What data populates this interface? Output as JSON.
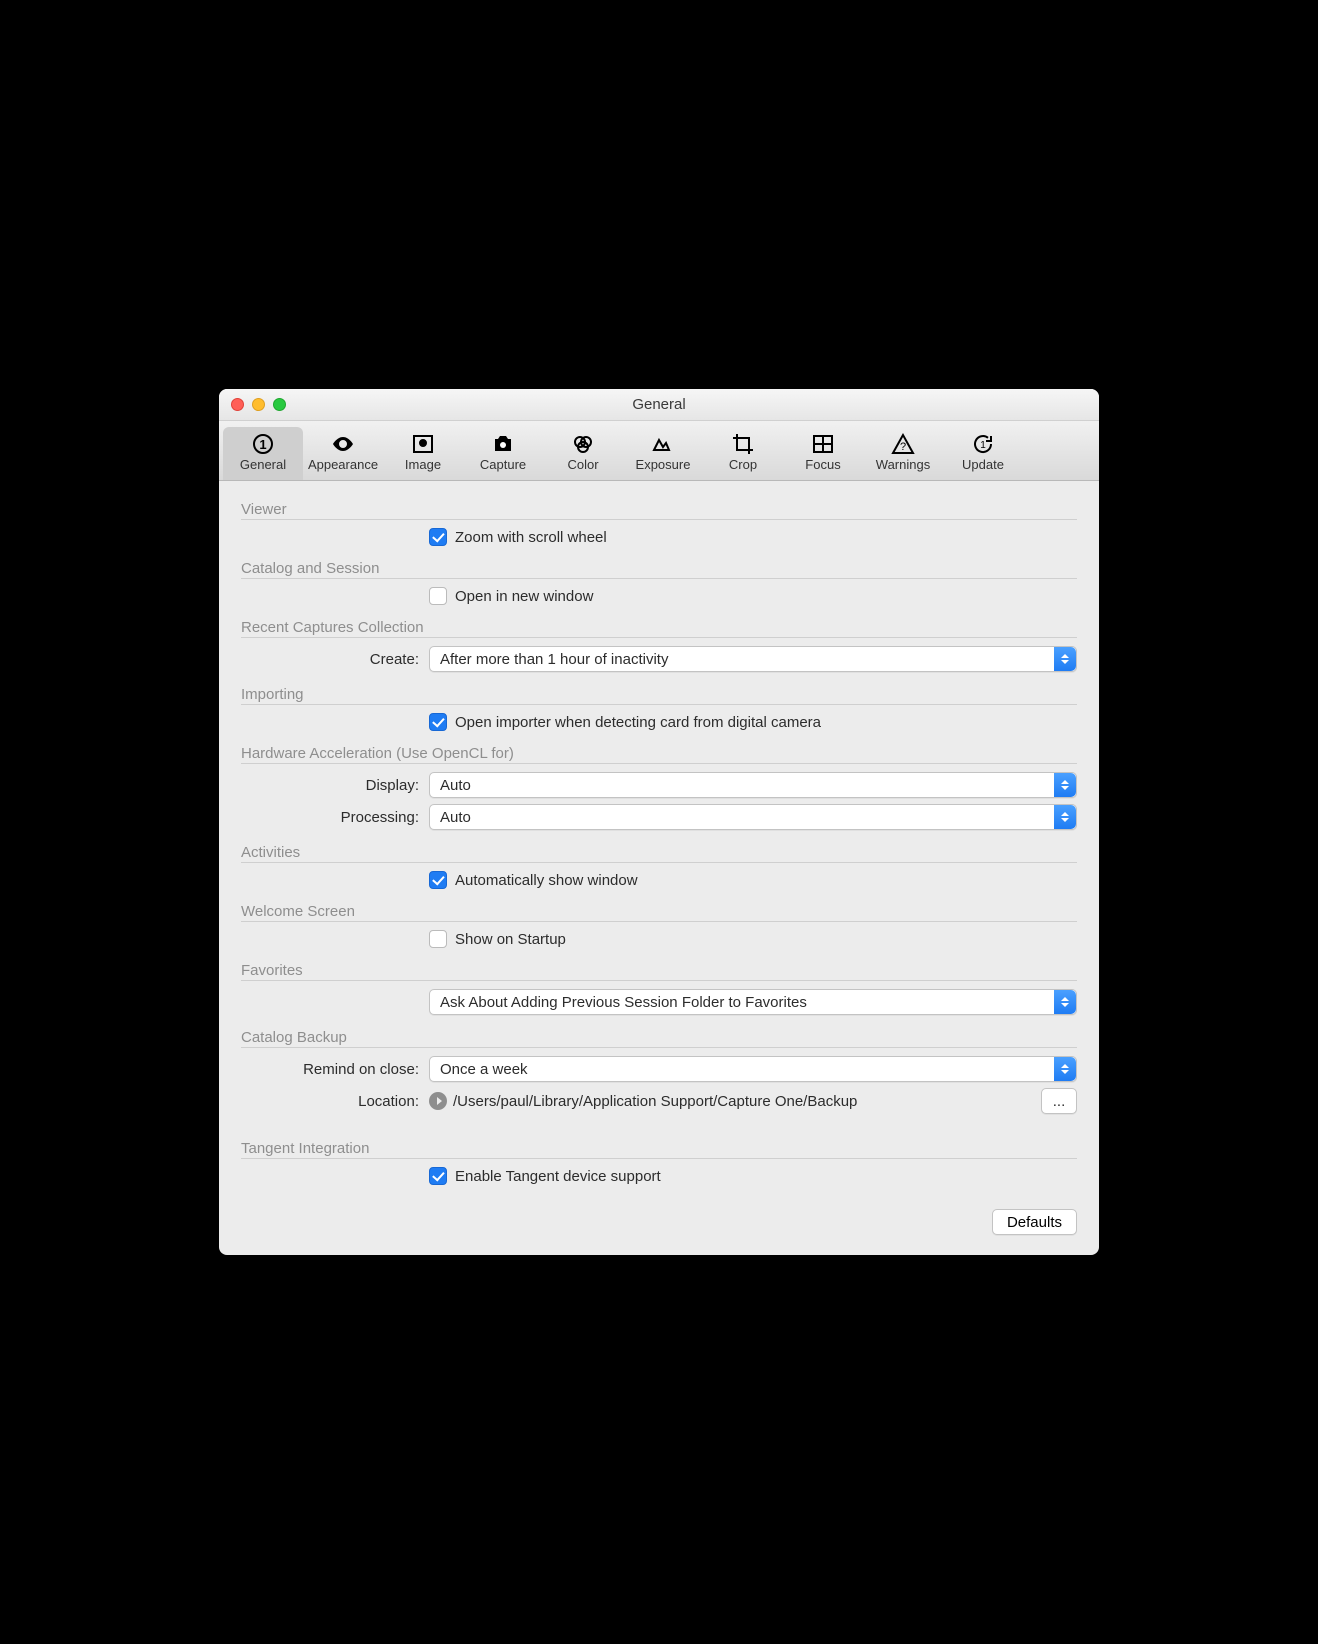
{
  "window": {
    "title": "General"
  },
  "toolbar": {
    "tabs": [
      {
        "label": "General"
      },
      {
        "label": "Appearance"
      },
      {
        "label": "Image"
      },
      {
        "label": "Capture"
      },
      {
        "label": "Color"
      },
      {
        "label": "Exposure"
      },
      {
        "label": "Crop"
      },
      {
        "label": "Focus"
      },
      {
        "label": "Warnings"
      },
      {
        "label": "Update"
      }
    ],
    "selected": 0
  },
  "sections": {
    "viewer": {
      "label": "Viewer",
      "zoom_scroll_label": "Zoom with scroll wheel",
      "zoom_scroll_checked": true
    },
    "catalog_session": {
      "label": "Catalog and Session",
      "open_new_label": "Open in new window",
      "open_new_checked": false
    },
    "recent_captures": {
      "label": "Recent Captures Collection",
      "create_label": "Create:",
      "create_value": "After more than 1 hour of inactivity"
    },
    "importing": {
      "label": "Importing",
      "open_importer_label": "Open importer when detecting card from digital camera",
      "open_importer_checked": true
    },
    "hw_accel": {
      "label": "Hardware Acceleration (Use OpenCL for)",
      "display_label": "Display:",
      "display_value": "Auto",
      "processing_label": "Processing:",
      "processing_value": "Auto"
    },
    "activities": {
      "label": "Activities",
      "auto_show_label": "Automatically show window",
      "auto_show_checked": true
    },
    "welcome": {
      "label": "Welcome Screen",
      "show_startup_label": "Show on Startup",
      "show_startup_checked": false
    },
    "favorites": {
      "label": "Favorites",
      "value": "Ask About Adding Previous Session Folder to Favorites"
    },
    "backup": {
      "label": "Catalog Backup",
      "remind_label": "Remind on close:",
      "remind_value": "Once a week",
      "location_label": "Location:",
      "location_path": "/Users/paul/Library/Application Support/Capture One/Backup",
      "browse_label": "..."
    },
    "tangent": {
      "label": "Tangent Integration",
      "enable_label": "Enable Tangent device support",
      "enable_checked": true
    }
  },
  "footer": {
    "defaults_label": "Defaults"
  }
}
